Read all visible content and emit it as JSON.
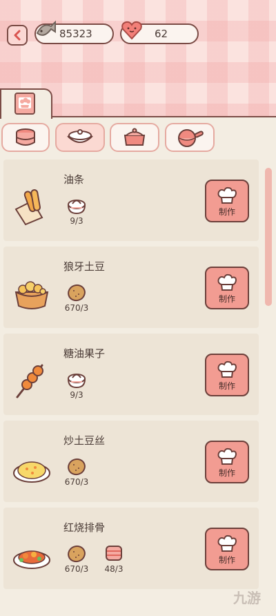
{
  "header": {
    "fish_count": "85323",
    "heart_count": "62"
  },
  "filters": [
    {
      "name": "stack",
      "active": false
    },
    {
      "name": "steamed-bun",
      "active": true
    },
    {
      "name": "pot",
      "active": false
    },
    {
      "name": "pan",
      "active": false
    }
  ],
  "recipes": [
    {
      "name": "油条",
      "ingredients": [
        {
          "icon": "flour-bag-icon",
          "count": "9/3"
        }
      ],
      "button": "制作"
    },
    {
      "name": "狼牙土豆",
      "ingredients": [
        {
          "icon": "potato-icon",
          "count": "670/3"
        }
      ],
      "button": "制作"
    },
    {
      "name": "糖油果子",
      "ingredients": [
        {
          "icon": "flour-bag-icon",
          "count": "9/3"
        }
      ],
      "button": "制作"
    },
    {
      "name": "炒土豆丝",
      "ingredients": [
        {
          "icon": "potato-icon",
          "count": "670/3"
        }
      ],
      "button": "制作"
    },
    {
      "name": "红烧排骨",
      "ingredients": [
        {
          "icon": "potato-icon",
          "count": "670/3"
        },
        {
          "icon": "meat-icon",
          "count": "48/3"
        }
      ],
      "button": "制作"
    }
  ],
  "watermark": "九游"
}
